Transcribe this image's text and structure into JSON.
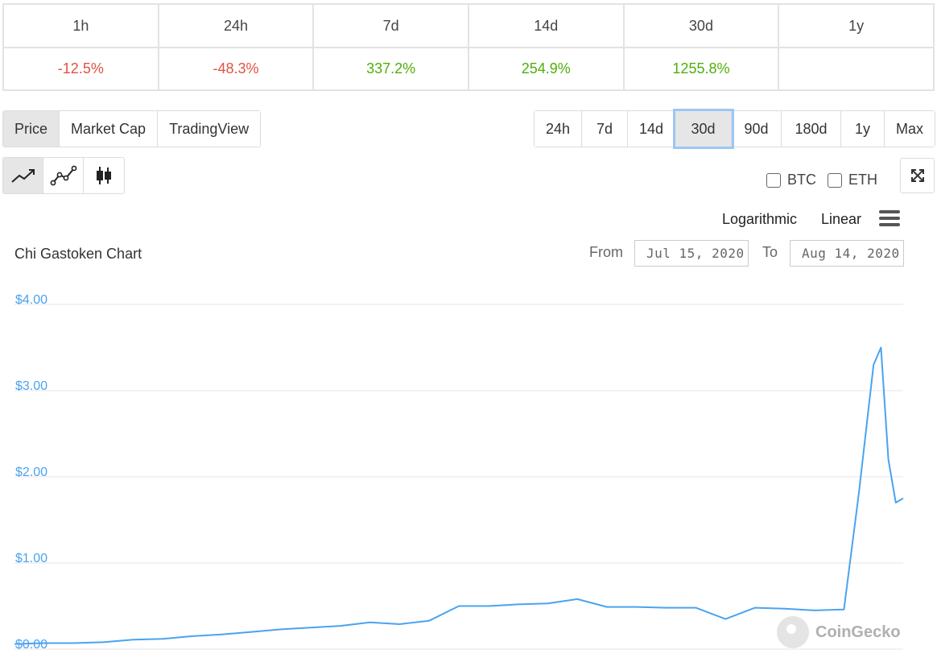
{
  "performance": {
    "periods": [
      "1h",
      "24h",
      "7d",
      "14d",
      "30d",
      "1y"
    ],
    "changes": [
      {
        "value": "-12.5%",
        "trend": "neg"
      },
      {
        "value": "-48.3%",
        "trend": "neg"
      },
      {
        "value": "337.2%",
        "trend": "pos"
      },
      {
        "value": "254.9%",
        "trend": "pos"
      },
      {
        "value": "1255.8%",
        "trend": "pos"
      },
      {
        "value": "",
        "trend": ""
      }
    ]
  },
  "tabs": {
    "items": [
      "Price",
      "Market Cap",
      "TradingView"
    ],
    "active": "Price"
  },
  "ranges": {
    "items": [
      "24h",
      "7d",
      "14d",
      "30d",
      "90d",
      "180d",
      "1y",
      "Max"
    ],
    "active": "30d"
  },
  "chart_types": {
    "items": [
      "line-chart-icon",
      "line-points-chart-icon",
      "candlestick-chart-icon"
    ],
    "active": "line-chart-icon"
  },
  "compare": {
    "btc_label": "BTC",
    "eth_label": "ETH"
  },
  "scale": {
    "log_label": "Logarithmic",
    "linear_label": "Linear"
  },
  "date_range": {
    "from_label": "From",
    "from_value": "Jul 15, 2020",
    "to_label": "To",
    "to_value": "Aug 14, 2020"
  },
  "watermark": "CoinGecko",
  "colors": {
    "line": "#4aa3f0",
    "negative": "#e15241",
    "positive": "#4eaf0a"
  },
  "chart_data": {
    "type": "line",
    "title": "Chi Gastoken Chart",
    "xlabel": "",
    "ylabel": "",
    "xlim": [
      "2020-07-15",
      "2020-08-14"
    ],
    "ylim": [
      0,
      4
    ],
    "yticks": [
      "$0.00",
      "$1.00",
      "$2.00",
      "$3.00",
      "$4.00"
    ],
    "ytick_values": [
      0,
      1,
      2,
      3,
      4
    ],
    "grid": true,
    "legend": false,
    "series": [
      {
        "values": [
          [
            "2020-07-15",
            0.06
          ],
          [
            "2020-07-16",
            0.07
          ],
          [
            "2020-07-17",
            0.07
          ],
          [
            "2020-07-18",
            0.08
          ],
          [
            "2020-07-19",
            0.11
          ],
          [
            "2020-07-20",
            0.12
          ],
          [
            "2020-07-21",
            0.15
          ],
          [
            "2020-07-22",
            0.17
          ],
          [
            "2020-07-23",
            0.2
          ],
          [
            "2020-07-24",
            0.23
          ],
          [
            "2020-07-25",
            0.25
          ],
          [
            "2020-07-26",
            0.27
          ],
          [
            "2020-07-27",
            0.31
          ],
          [
            "2020-07-28",
            0.29
          ],
          [
            "2020-07-29",
            0.33
          ],
          [
            "2020-07-30",
            0.5
          ],
          [
            "2020-07-31",
            0.5
          ],
          [
            "2020-08-01",
            0.52
          ],
          [
            "2020-08-02",
            0.53
          ],
          [
            "2020-08-03",
            0.58
          ],
          [
            "2020-08-04",
            0.49
          ],
          [
            "2020-08-05",
            0.49
          ],
          [
            "2020-08-06",
            0.48
          ],
          [
            "2020-08-07",
            0.48
          ],
          [
            "2020-08-08",
            0.35
          ],
          [
            "2020-08-09",
            0.48
          ],
          [
            "2020-08-10",
            0.47
          ],
          [
            "2020-08-11",
            0.45
          ],
          [
            "2020-08-12",
            0.46
          ],
          [
            "2020-08-12 12:00",
            1.8
          ],
          [
            "2020-08-13",
            3.3
          ],
          [
            "2020-08-13 06:00",
            3.5
          ],
          [
            "2020-08-13 12:00",
            2.2
          ],
          [
            "2020-08-13 18:00",
            1.7
          ],
          [
            "2020-08-14",
            1.75
          ]
        ]
      }
    ]
  }
}
